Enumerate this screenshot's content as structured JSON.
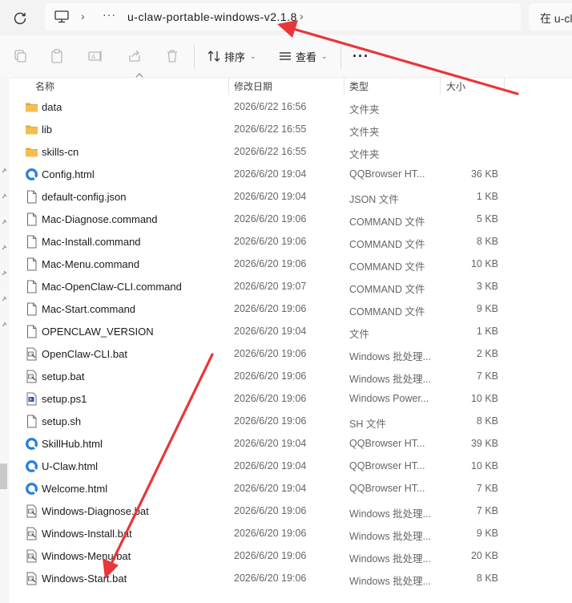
{
  "address": {
    "dots": "···",
    "path": "u-claw-portable-windows-v2.1.8",
    "search_placeholder": "在 u-cl"
  },
  "toolbar": {
    "sort_label": "排序",
    "view_label": "查看",
    "more_label": "···"
  },
  "columns": {
    "name": "名称",
    "modified": "修改日期",
    "type": "类型",
    "size": "大小"
  },
  "files": [
    {
      "name": "data",
      "date": "2026/6/22 16:56",
      "type": "文件夹",
      "size": "",
      "icon": "folder-icon"
    },
    {
      "name": "lib",
      "date": "2026/6/22 16:55",
      "type": "文件夹",
      "size": "",
      "icon": "folder-icon"
    },
    {
      "name": "skills-cn",
      "date": "2026/6/22 16:55",
      "type": "文件夹",
      "size": "",
      "icon": "folder-icon"
    },
    {
      "name": "Config.html",
      "date": "2026/6/20 19:04",
      "type": "QQBrowser HT...",
      "size": "36 KB",
      "icon": "browser-html-icon"
    },
    {
      "name": "default-config.json",
      "date": "2026/6/20 19:04",
      "type": "JSON 文件",
      "size": "1 KB",
      "icon": "file-icon"
    },
    {
      "name": "Mac-Diagnose.command",
      "date": "2026/6/20 19:06",
      "type": "COMMAND 文件",
      "size": "5 KB",
      "icon": "file-icon"
    },
    {
      "name": "Mac-Install.command",
      "date": "2026/6/20 19:06",
      "type": "COMMAND 文件",
      "size": "8 KB",
      "icon": "file-icon"
    },
    {
      "name": "Mac-Menu.command",
      "date": "2026/6/20 19:06",
      "type": "COMMAND 文件",
      "size": "10 KB",
      "icon": "file-icon"
    },
    {
      "name": "Mac-OpenClaw-CLI.command",
      "date": "2026/6/20 19:07",
      "type": "COMMAND 文件",
      "size": "3 KB",
      "icon": "file-icon"
    },
    {
      "name": "Mac-Start.command",
      "date": "2026/6/20 19:06",
      "type": "COMMAND 文件",
      "size": "9 KB",
      "icon": "file-icon"
    },
    {
      "name": "OPENCLAW_VERSION",
      "date": "2026/6/20 19:04",
      "type": "文件",
      "size": "1 KB",
      "icon": "file-icon"
    },
    {
      "name": "OpenClaw-CLI.bat",
      "date": "2026/6/20 19:06",
      "type": "Windows 批处理...",
      "size": "2 KB",
      "icon": "batch-file-icon"
    },
    {
      "name": "setup.bat",
      "date": "2026/6/20 19:06",
      "type": "Windows 批处理...",
      "size": "7 KB",
      "icon": "batch-file-icon"
    },
    {
      "name": "setup.ps1",
      "date": "2026/6/20 19:06",
      "type": "Windows Power...",
      "size": "10 KB",
      "icon": "powershell-file-icon"
    },
    {
      "name": "setup.sh",
      "date": "2026/6/20 19:06",
      "type": "SH 文件",
      "size": "8 KB",
      "icon": "file-icon"
    },
    {
      "name": "SkillHub.html",
      "date": "2026/6/20 19:04",
      "type": "QQBrowser HT...",
      "size": "39 KB",
      "icon": "browser-html-icon"
    },
    {
      "name": "U-Claw.html",
      "date": "2026/6/20 19:04",
      "type": "QQBrowser HT...",
      "size": "10 KB",
      "icon": "browser-html-icon"
    },
    {
      "name": "Welcome.html",
      "date": "2026/6/20 19:04",
      "type": "QQBrowser HT...",
      "size": "7 KB",
      "icon": "browser-html-icon"
    },
    {
      "name": "Windows-Diagnose.bat",
      "date": "2026/6/20 19:06",
      "type": "Windows 批处理...",
      "size": "7 KB",
      "icon": "batch-file-icon"
    },
    {
      "name": "Windows-Install.bat",
      "date": "2026/6/20 19:06",
      "type": "Windows 批处理...",
      "size": "9 KB",
      "icon": "batch-file-icon"
    },
    {
      "name": "Windows-Menu.bat",
      "date": "2026/6/20 19:06",
      "type": "Windows 批处理...",
      "size": "20 KB",
      "icon": "batch-file-icon"
    },
    {
      "name": "Windows-Start.bat",
      "date": "2026/6/20 19:06",
      "type": "Windows 批处理...",
      "size": "8 KB",
      "icon": "batch-file-icon"
    }
  ],
  "colors": {
    "folder": "#f4bf50",
    "browser_icon": "#2a7fe0",
    "annotation_arrow": "#e8373a"
  }
}
